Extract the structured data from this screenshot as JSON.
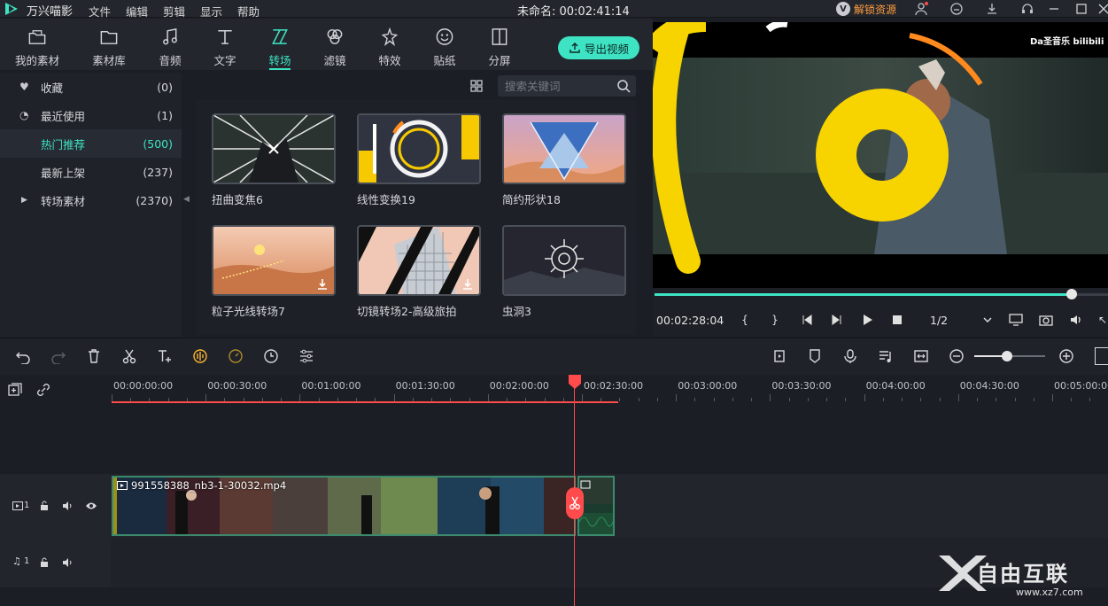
{
  "app": {
    "name": "万兴喵影",
    "menu": [
      "文件",
      "编辑",
      "剪辑",
      "显示",
      "帮助"
    ],
    "project_title": "未命名: 00:02:41:14",
    "unlock_label": "解锁资源"
  },
  "tools": {
    "items": [
      {
        "label": "我的素材",
        "icon": "folder-open-icon"
      },
      {
        "label": "素材库",
        "icon": "folder-icon"
      },
      {
        "label": "音频",
        "icon": "music-note-icon"
      },
      {
        "label": "文字",
        "icon": "text-icon"
      },
      {
        "label": "转场",
        "icon": "transition-icon"
      },
      {
        "label": "滤镜",
        "icon": "filter-icon"
      },
      {
        "label": "特效",
        "icon": "sparkle-icon"
      },
      {
        "label": "贴纸",
        "icon": "sticker-icon"
      },
      {
        "label": "分屏",
        "icon": "split-screen-icon"
      }
    ],
    "active_index": 4,
    "export_label": "导出视频"
  },
  "categories": [
    {
      "label": "收藏",
      "count": "(0)",
      "icon": "heart-icon"
    },
    {
      "label": "最近使用",
      "count": "(1)",
      "icon": "clock-icon"
    },
    {
      "label": "热门推荐",
      "count": "(500)",
      "icon": ""
    },
    {
      "label": "最新上架",
      "count": "(237)",
      "icon": ""
    },
    {
      "label": "转场素材",
      "count": "(2370)",
      "icon": "expand-arrow-icon"
    }
  ],
  "active_category": 2,
  "search": {
    "placeholder": "搜索关键词"
  },
  "thumbnails": [
    {
      "label": "扭曲变焦6",
      "download": false
    },
    {
      "label": "线性变换19",
      "download": false
    },
    {
      "label": "简约形状18",
      "download": false
    },
    {
      "label": "粒子光线转场7",
      "download": true
    },
    {
      "label": "切镜转场2-高级旅拍",
      "download": true
    },
    {
      "label": "虫洞3",
      "download": false
    }
  ],
  "preview": {
    "watermark": "Da圣音乐 bilibili",
    "timecode": "00:02:28:04",
    "quality": "1/2",
    "progress": 0.92
  },
  "timeline": {
    "ruler": [
      "00:00:00:00",
      "00:00:30:00",
      "00:01:00:00",
      "00:01:30:00",
      "00:02:00:00",
      "00:02:30:00",
      "00:03:00:00",
      "00:03:30:00",
      "00:04:00:00",
      "00:04:30:00",
      "00:05:00:00"
    ],
    "clip_name": "991558388_nb3-1-30032.mp4",
    "video_track_label": "1",
    "audio_track_label": "1"
  },
  "site_watermark": {
    "text": "自由互联",
    "url": "www.xz7.com"
  },
  "colors": {
    "accent": "#3ee3c3",
    "playhead": "#ff4b4b",
    "unlock": "#ff9d3d"
  }
}
